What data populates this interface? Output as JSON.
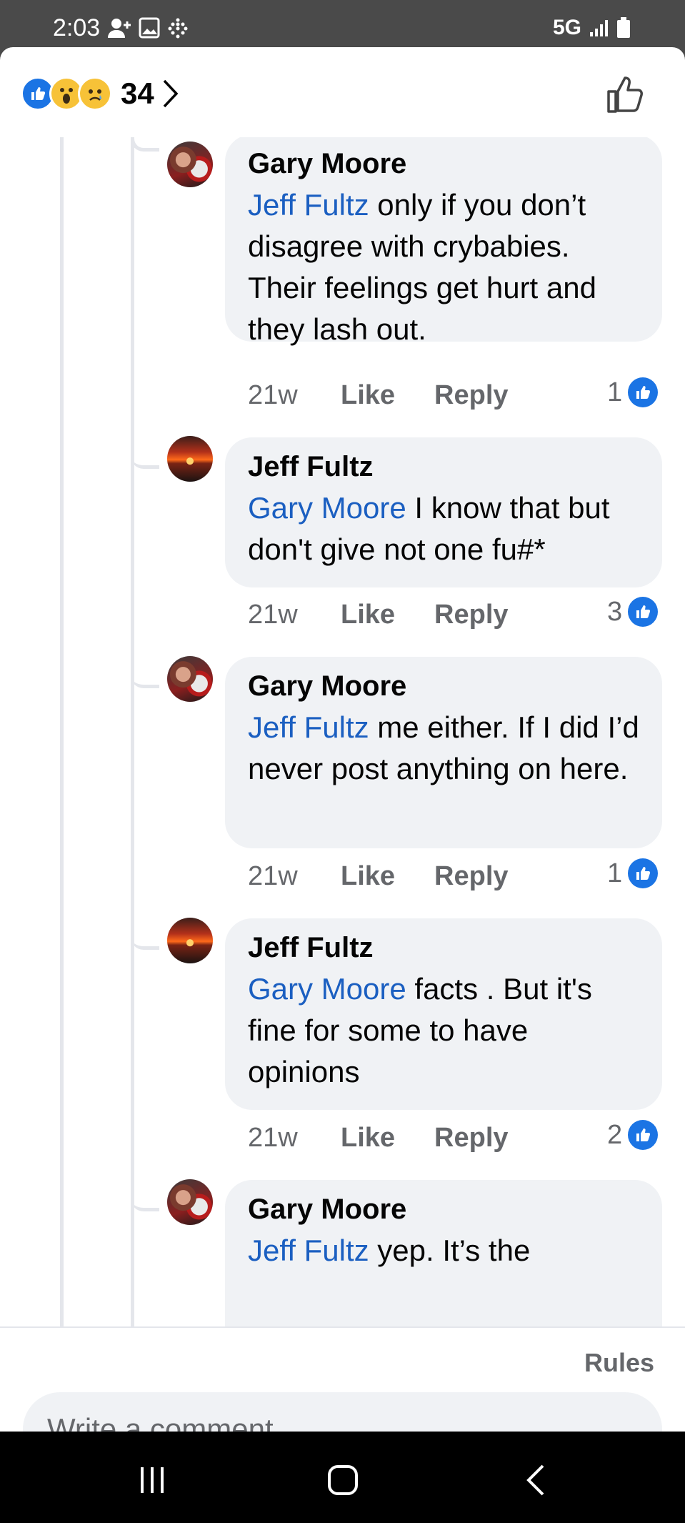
{
  "status_bar": {
    "time": "2:03",
    "network": "5G"
  },
  "header": {
    "reaction_icons": [
      "like-reaction-icon",
      "wow-reaction-icon",
      "sad-reaction-icon"
    ],
    "reaction_count": "34"
  },
  "comments": [
    {
      "author": "Gary Moore",
      "mention": "Jeff Fultz",
      "text": " only if you don’t disagree with crybabies. Their feelings get hurt and they lash out.",
      "time": "21w",
      "like_label": "Like",
      "reply_label": "Reply",
      "reactions": "1"
    },
    {
      "author": "Jeff Fultz",
      "mention": "Gary Moore",
      "text": " I know that but don't give not one fu#*",
      "time": "21w",
      "like_label": "Like",
      "reply_label": "Reply",
      "reactions": "3"
    },
    {
      "author": "Gary Moore",
      "mention": "Jeff Fultz",
      "text": " me either. If I did I’d never post anything on here.",
      "time": "21w",
      "like_label": "Like",
      "reply_label": "Reply",
      "reactions": "1"
    },
    {
      "author": "Jeff Fultz",
      "mention": "Gary Moore",
      "text": " facts . But it's fine for some to have opinions",
      "time": "21w",
      "like_label": "Like",
      "reply_label": "Reply",
      "reactions": "2"
    },
    {
      "author": "Gary Moore",
      "mention": "Jeff Fultz",
      "text": " yep. It’s the"
    }
  ],
  "footer": {
    "rules_label": "Rules",
    "comment_placeholder": "Write a comment…"
  },
  "colors": {
    "accent": "#1b74e4",
    "mention": "#1b5fc1",
    "bubble": "#f0f2f5",
    "muted_text": "#65676b"
  }
}
